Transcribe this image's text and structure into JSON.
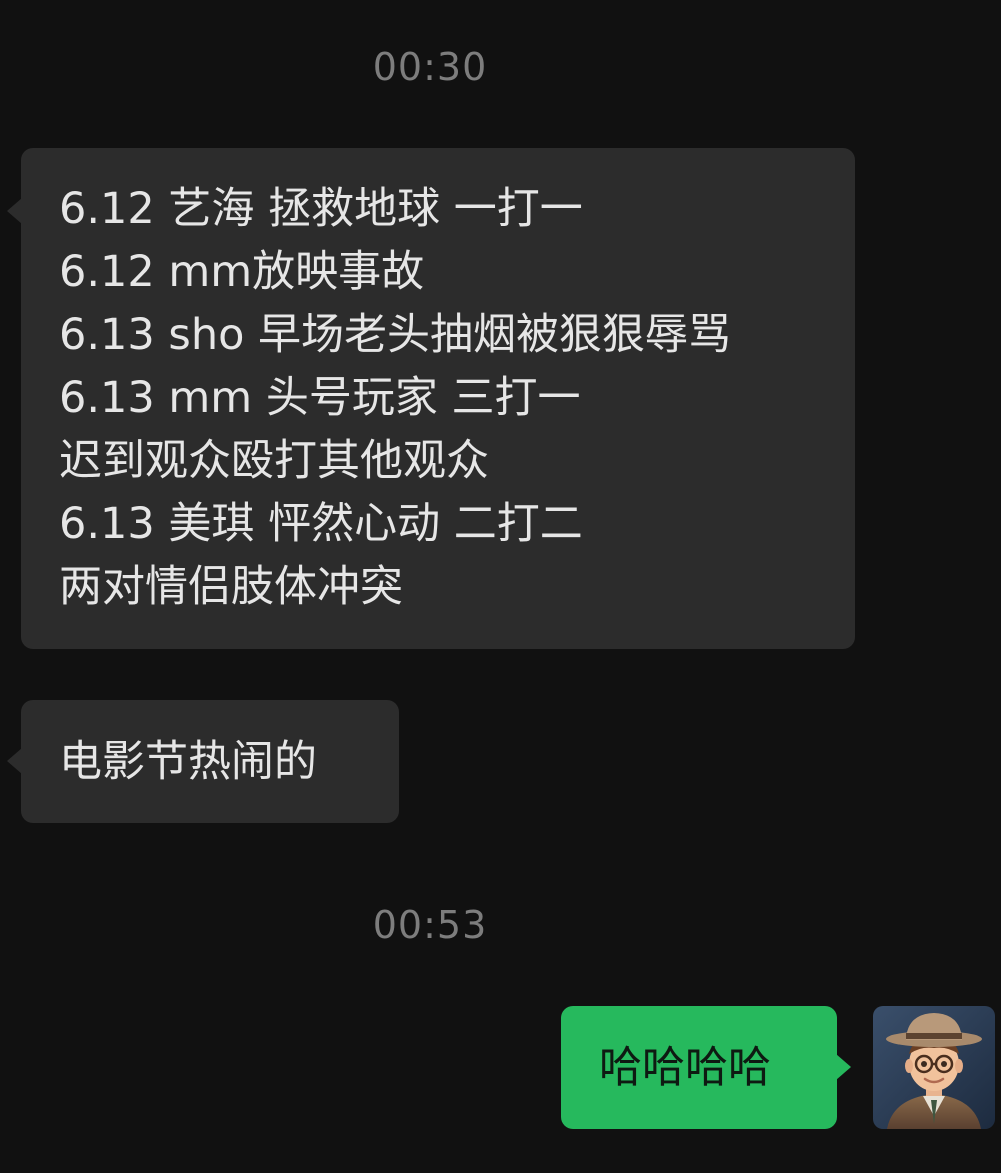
{
  "chat": {
    "messages": [
      {
        "type": "timestamp",
        "text": "00:30"
      },
      {
        "type": "incoming",
        "lines": [
          "6.12 艺海 拯救地球 一打一",
          "6.12 mm放映事故",
          "6.13 sho 早场老头抽烟被狠狠辱骂",
          "6.13 mm 头号玩家 三打一",
          "迟到观众殴打其他观众",
          "6.13 美琪 怦然心动 二打二",
          "两对情侣肢体冲突"
        ]
      },
      {
        "type": "incoming",
        "text": "电影节热闹的"
      },
      {
        "type": "timestamp",
        "text": "00:53"
      },
      {
        "type": "outgoing",
        "text": "哈哈哈哈",
        "avatar_icon": "user-avatar-cartoon-man-hat-glasses"
      }
    ]
  },
  "colors": {
    "background": "#111111",
    "incoming_bubble": "#2c2c2c",
    "outgoing_bubble": "#26b95d",
    "timestamp_text": "#7d7d7d"
  }
}
